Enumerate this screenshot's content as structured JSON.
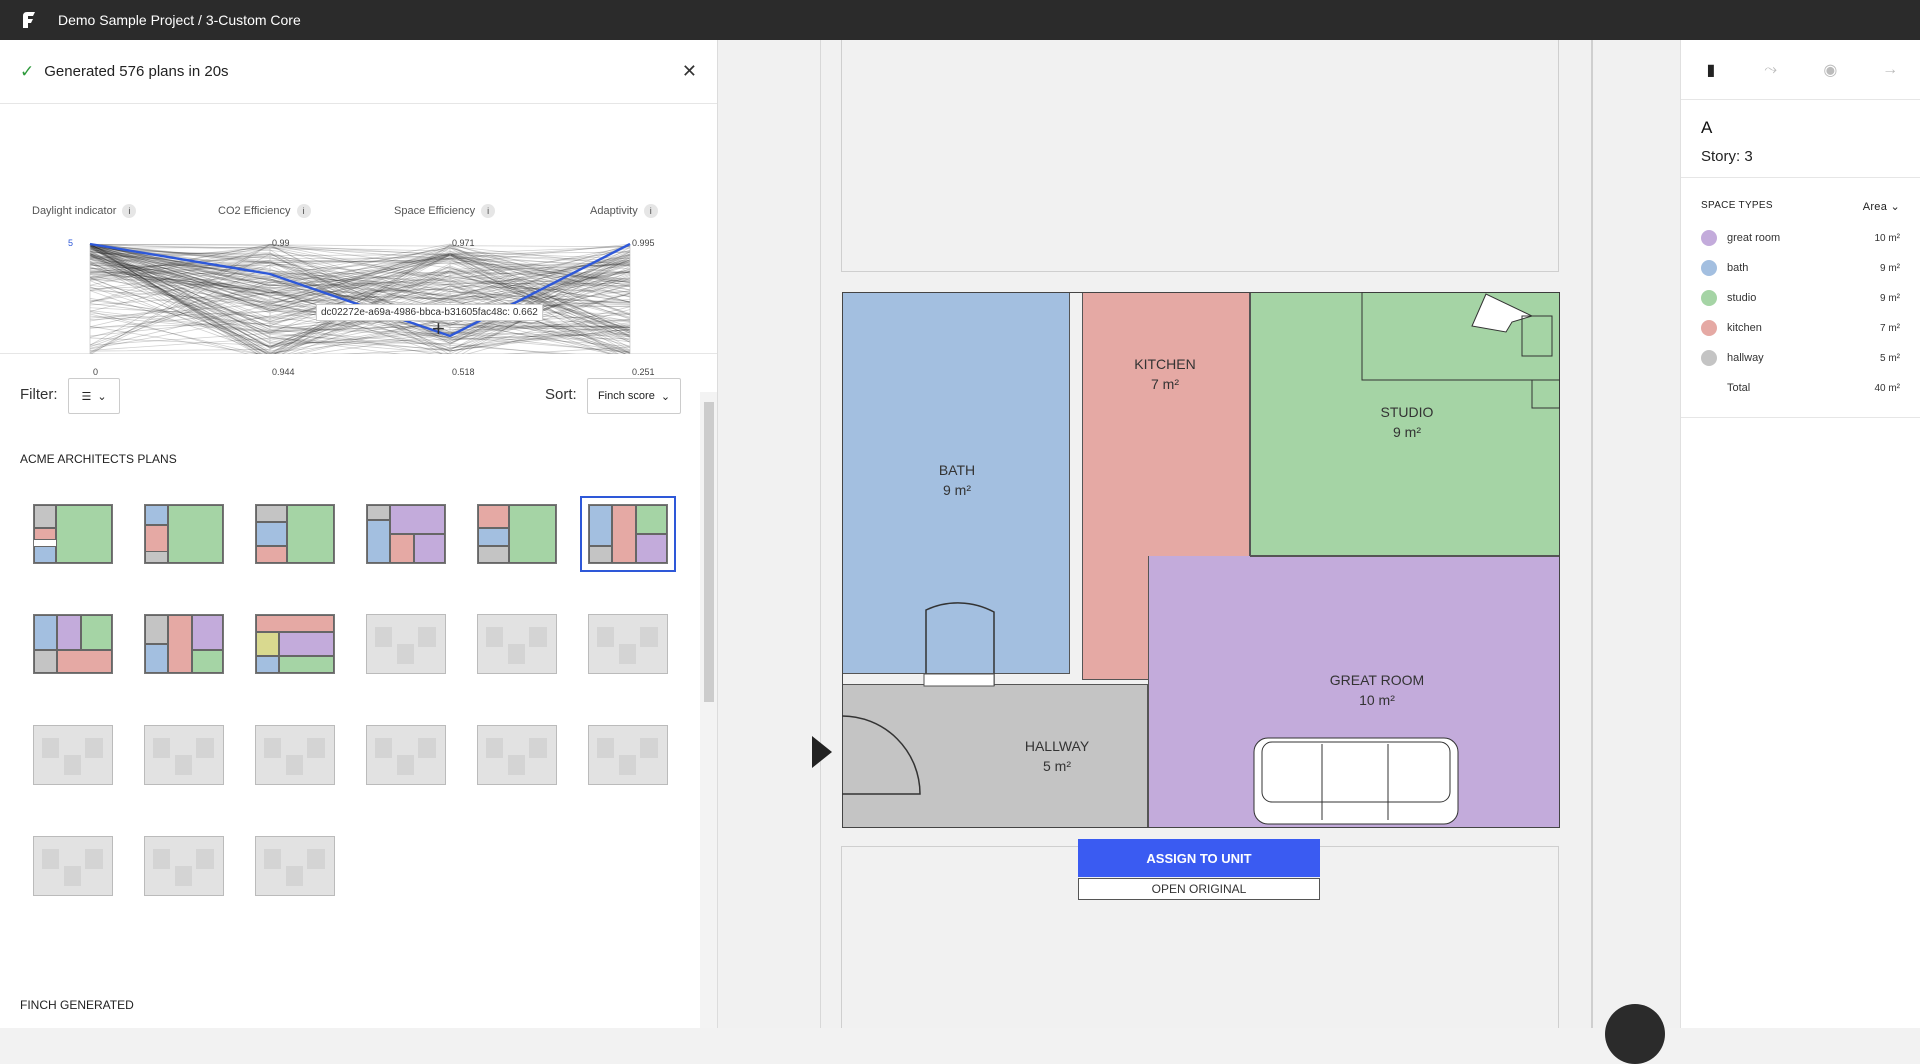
{
  "header": {
    "title": "Demo Sample Project / 3-Custom Core"
  },
  "status": {
    "text": "Generated 576 plans in 20s"
  },
  "parallel_coords": {
    "headers": [
      "Daylight indicator",
      "CO2 Efficiency",
      "Space Efficiency",
      "Adaptivity"
    ],
    "top_ticks": [
      "5",
      "0.99",
      "0.971",
      "0.995"
    ],
    "bottom_ticks": [
      "0",
      "0.944",
      "0.518",
      "0.251"
    ],
    "tooltip": "dc02272e-a69a-4986-bbca-b31605fac48c: 0.662",
    "highlight_color": "#2e58d8"
  },
  "filter": {
    "label": "Filter:",
    "sort_label": "Sort:",
    "sort_value": "Finch score"
  },
  "sections": {
    "acme": "ACME ARCHITECTS PLANS",
    "finch": "FINCH GENERATED"
  },
  "floorplan": {
    "rooms": [
      {
        "name": "BATH",
        "area": "9 m²"
      },
      {
        "name": "KITCHEN",
        "area": "7 m²"
      },
      {
        "name": "STUDIO",
        "area": "9 m²"
      },
      {
        "name": "GREAT ROOM",
        "area": "10 m²"
      },
      {
        "name": "HALLWAY",
        "area": "5 m²"
      }
    ],
    "assign_label": "ASSIGN TO UNIT",
    "open_label": "OPEN ORIGINAL"
  },
  "right_panel": {
    "unit": "A",
    "story": "Story: 3",
    "space_types_title": "SPACE TYPES",
    "sort_label": "Area",
    "types": [
      {
        "name": "great room",
        "value": "10 m²",
        "color": "#c3abdb"
      },
      {
        "name": "bath",
        "value": "9 m²",
        "color": "#a3bfe0"
      },
      {
        "name": "studio",
        "value": "9 m²",
        "color": "#a5d4a5"
      },
      {
        "name": "kitchen",
        "value": "7 m²",
        "color": "#e5a9a4"
      },
      {
        "name": "hallway",
        "value": "5 m²",
        "color": "#c4c4c4"
      }
    ],
    "total_label": "Total",
    "total_value": "40 m²"
  },
  "colors": {
    "accent": "#3a5bf2",
    "bath": "#a3bfe0",
    "kitchen": "#e5a9a4",
    "studio": "#a5d4a5",
    "great_room": "#c3abdb",
    "hallway": "#c4c4c4"
  }
}
